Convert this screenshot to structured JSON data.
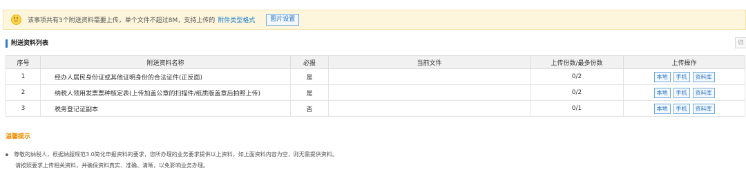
{
  "notice": {
    "text": "该事项共有3个附送资料需要上传，单个文件不超过8M，支持上传的",
    "link": "附件类型格式",
    "button": "图片设置"
  },
  "section": {
    "title": "附送资料列表",
    "corner_button": "归"
  },
  "table": {
    "headers": [
      "序号",
      "附送资料名称",
      "必报",
      "当前文件",
      "上传份数/最多份数",
      "上传操作"
    ],
    "rows": [
      {
        "no": "1",
        "name": "经办人居民身份证或其他证明身份的合法证件(正反面)",
        "required": "是",
        "file": "",
        "count": "0/2"
      },
      {
        "no": "2",
        "name": "纳税人领用发票票种核定表(上传加盖公章的扫描件/纸质版盖章后拍照上传)",
        "required": "是",
        "file": "",
        "count": "0/2"
      },
      {
        "no": "3",
        "name": "税务登记证副本",
        "required": "否",
        "file": "",
        "count": "0/1"
      }
    ],
    "op_labels": {
      "local": "本地",
      "phone": "手机",
      "library": "资料库"
    }
  },
  "tips": {
    "title": "温馨提示",
    "line1": "尊敬的纳税人，根据纳服规范3.0简化申报资料的要求，您所办理的业务要求提供以上资料，如上面资料内容为空，则无需提供资料。",
    "line2": "请按照要求上传相关资料，并确保资料真实、准确、清晰，以免影响业务办理。"
  }
}
